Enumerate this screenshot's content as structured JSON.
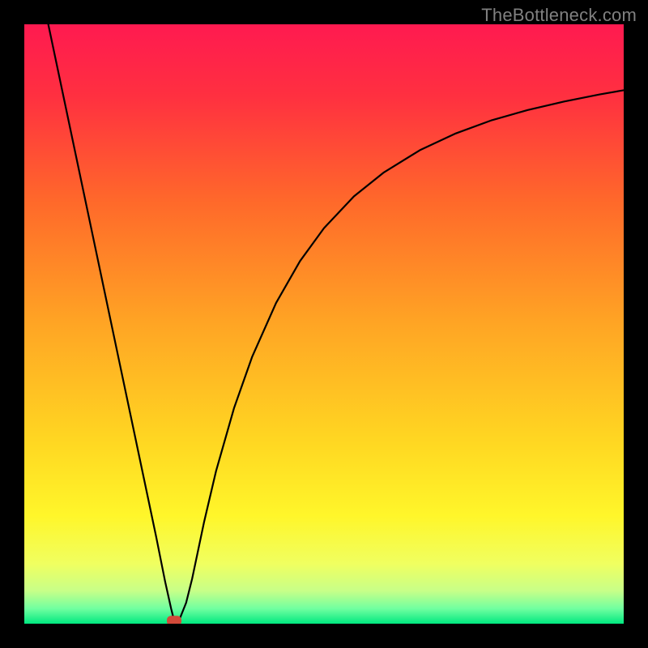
{
  "watermark": {
    "text": "TheBottleneck.com"
  },
  "chart_data": {
    "type": "line",
    "title": "",
    "xlabel": "",
    "ylabel": "",
    "xlim": [
      0,
      100
    ],
    "ylim": [
      0,
      100
    ],
    "grid": false,
    "legend": false,
    "background": {
      "type": "vertical-gradient",
      "stops": [
        {
          "pos": 0.0,
          "color": "#ff1a50"
        },
        {
          "pos": 0.12,
          "color": "#ff3040"
        },
        {
          "pos": 0.3,
          "color": "#ff6a2a"
        },
        {
          "pos": 0.5,
          "color": "#ffa524"
        },
        {
          "pos": 0.7,
          "color": "#ffd822"
        },
        {
          "pos": 0.82,
          "color": "#fff62a"
        },
        {
          "pos": 0.9,
          "color": "#f0ff60"
        },
        {
          "pos": 0.945,
          "color": "#c8ff88"
        },
        {
          "pos": 0.975,
          "color": "#70ffa0"
        },
        {
          "pos": 1.0,
          "color": "#00e880"
        }
      ]
    },
    "series": [
      {
        "name": "bottleneck-curve",
        "color": "#000000",
        "x": [
          4.0,
          8.0,
          12.0,
          16.0,
          20.0,
          22.0,
          23.5,
          24.5,
          25.0,
          25.5,
          26.0,
          27.0,
          28.0,
          30.0,
          32.0,
          35.0,
          38.0,
          42.0,
          46.0,
          50.0,
          55.0,
          60.0,
          66.0,
          72.0,
          78.0,
          84.0,
          90.0,
          96.0,
          100.0
        ],
        "values": [
          100.0,
          81.0,
          62.0,
          43.0,
          24.0,
          14.5,
          7.0,
          2.5,
          0.5,
          0.5,
          1.0,
          3.5,
          7.5,
          17.0,
          25.5,
          36.0,
          44.5,
          53.5,
          60.5,
          66.0,
          71.3,
          75.3,
          79.0,
          81.8,
          84.0,
          85.7,
          87.1,
          88.3,
          89.0
        ]
      }
    ],
    "marker": {
      "name": "minimum-point",
      "x": 25.0,
      "y": 0.5,
      "color": "#d24a3a",
      "shape": "rounded-rect"
    }
  }
}
